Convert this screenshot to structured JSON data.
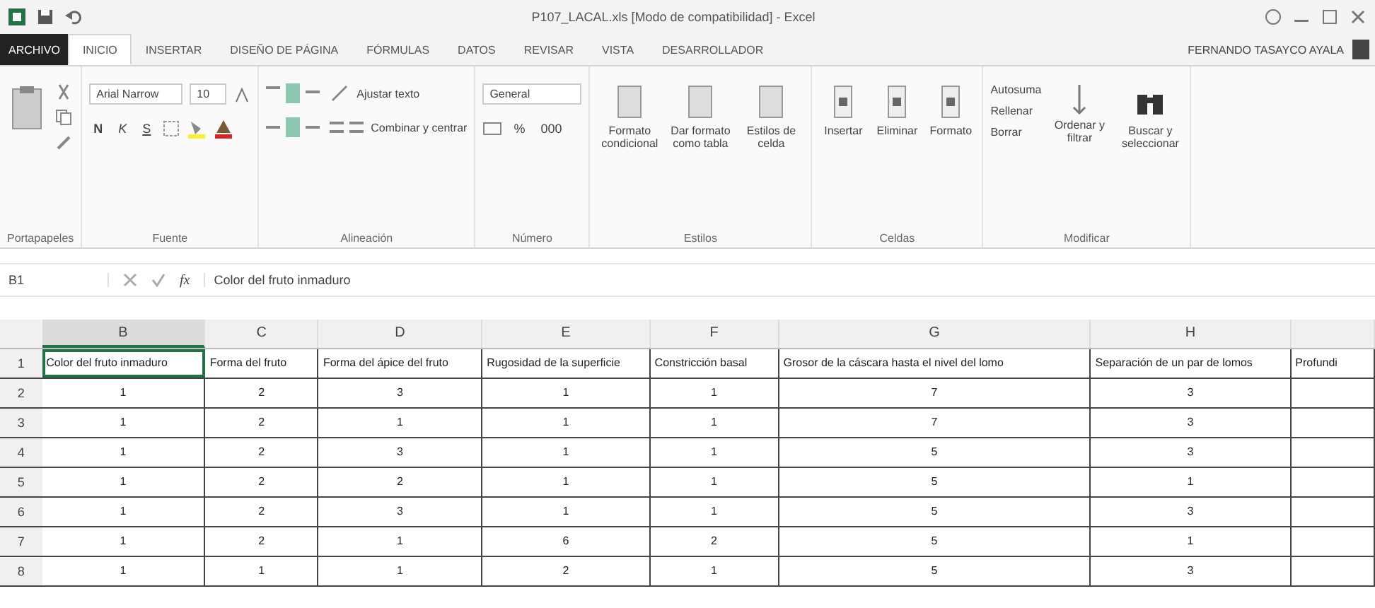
{
  "window": {
    "title": "P107_LACAL.xls [Modo de compatibilidad] - Excel",
    "account": "FERNANDO TASAYCO AYALA"
  },
  "tabs": [
    {
      "label": "ARCHIVO",
      "kind": "file",
      "selected": false
    },
    {
      "label": "INICIO",
      "kind": "tab",
      "selected": true
    },
    {
      "label": "INSERTAR",
      "kind": "tab",
      "selected": false
    },
    {
      "label": "DISEÑO DE PÁGINA",
      "kind": "tab",
      "selected": false
    },
    {
      "label": "FÓRMULAS",
      "kind": "tab",
      "selected": false
    },
    {
      "label": "DATOS",
      "kind": "tab",
      "selected": false
    },
    {
      "label": "REVISAR",
      "kind": "tab",
      "selected": false
    },
    {
      "label": "VISTA",
      "kind": "tab",
      "selected": false
    },
    {
      "label": "DESARROLLADOR",
      "kind": "tab",
      "selected": false
    }
  ],
  "ribbon": {
    "font_name": "Arial Narrow",
    "font_size": "10",
    "bold": "N",
    "italic": "K",
    "underline": "S",
    "wrap": "Ajustar texto",
    "merge": "Combinar y centrar",
    "number_format": "General",
    "percent": "%",
    "thousands": "000",
    "styles": [
      "Formato condicional",
      "Dar formato como tabla",
      "Estilos de celda"
    ],
    "cells": [
      "Insertar",
      "Eliminar",
      "Formato"
    ],
    "edit_small": [
      "Autosuma",
      "Rellenar",
      "Borrar"
    ],
    "edit_big": [
      "Ordenar y filtrar",
      "Buscar y seleccionar"
    ],
    "groups": [
      "Portapapeles",
      "Fuente",
      "Alineación",
      "Número",
      "Estilos",
      "Celdas",
      "Modificar"
    ]
  },
  "formula_bar": {
    "name_box": "B1",
    "fx": "fx",
    "value": "Color del fruto inmaduro"
  },
  "sheet": {
    "columns": [
      {
        "letter": "B",
        "selected": true
      },
      {
        "letter": "C",
        "selected": false
      },
      {
        "letter": "D",
        "selected": false
      },
      {
        "letter": "E",
        "selected": false
      },
      {
        "letter": "F",
        "selected": false
      },
      {
        "letter": "G",
        "selected": false
      },
      {
        "letter": "H",
        "selected": false
      },
      {
        "selected": false
      }
    ],
    "rows": [
      {
        "n": "1",
        "cells": [
          "Color del fruto inmaduro",
          "Forma del fruto",
          "Forma del ápice del fruto",
          "Rugosidad de la superficie",
          "Constricción basal",
          "Grosor de la cáscara hasta el nivel del lomo",
          "Separación de un par de lomos",
          "Profundi"
        ]
      },
      {
        "n": "2",
        "cells": [
          "1",
          "2",
          "3",
          "1",
          "1",
          "7",
          "3",
          ""
        ]
      },
      {
        "n": "3",
        "cells": [
          "1",
          "2",
          "1",
          "1",
          "1",
          "7",
          "3",
          ""
        ]
      },
      {
        "n": "4",
        "cells": [
          "1",
          "2",
          "3",
          "1",
          "1",
          "5",
          "3",
          ""
        ]
      },
      {
        "n": "5",
        "cells": [
          "1",
          "2",
          "2",
          "1",
          "1",
          "5",
          "1",
          ""
        ]
      },
      {
        "n": "6",
        "cells": [
          "1",
          "2",
          "3",
          "1",
          "1",
          "5",
          "3",
          ""
        ]
      },
      {
        "n": "7",
        "cells": [
          "1",
          "2",
          "1",
          "6",
          "2",
          "5",
          "1",
          ""
        ]
      },
      {
        "n": "8",
        "cells": [
          "1",
          "1",
          "1",
          "2",
          "1",
          "5",
          "3",
          ""
        ]
      }
    ]
  }
}
